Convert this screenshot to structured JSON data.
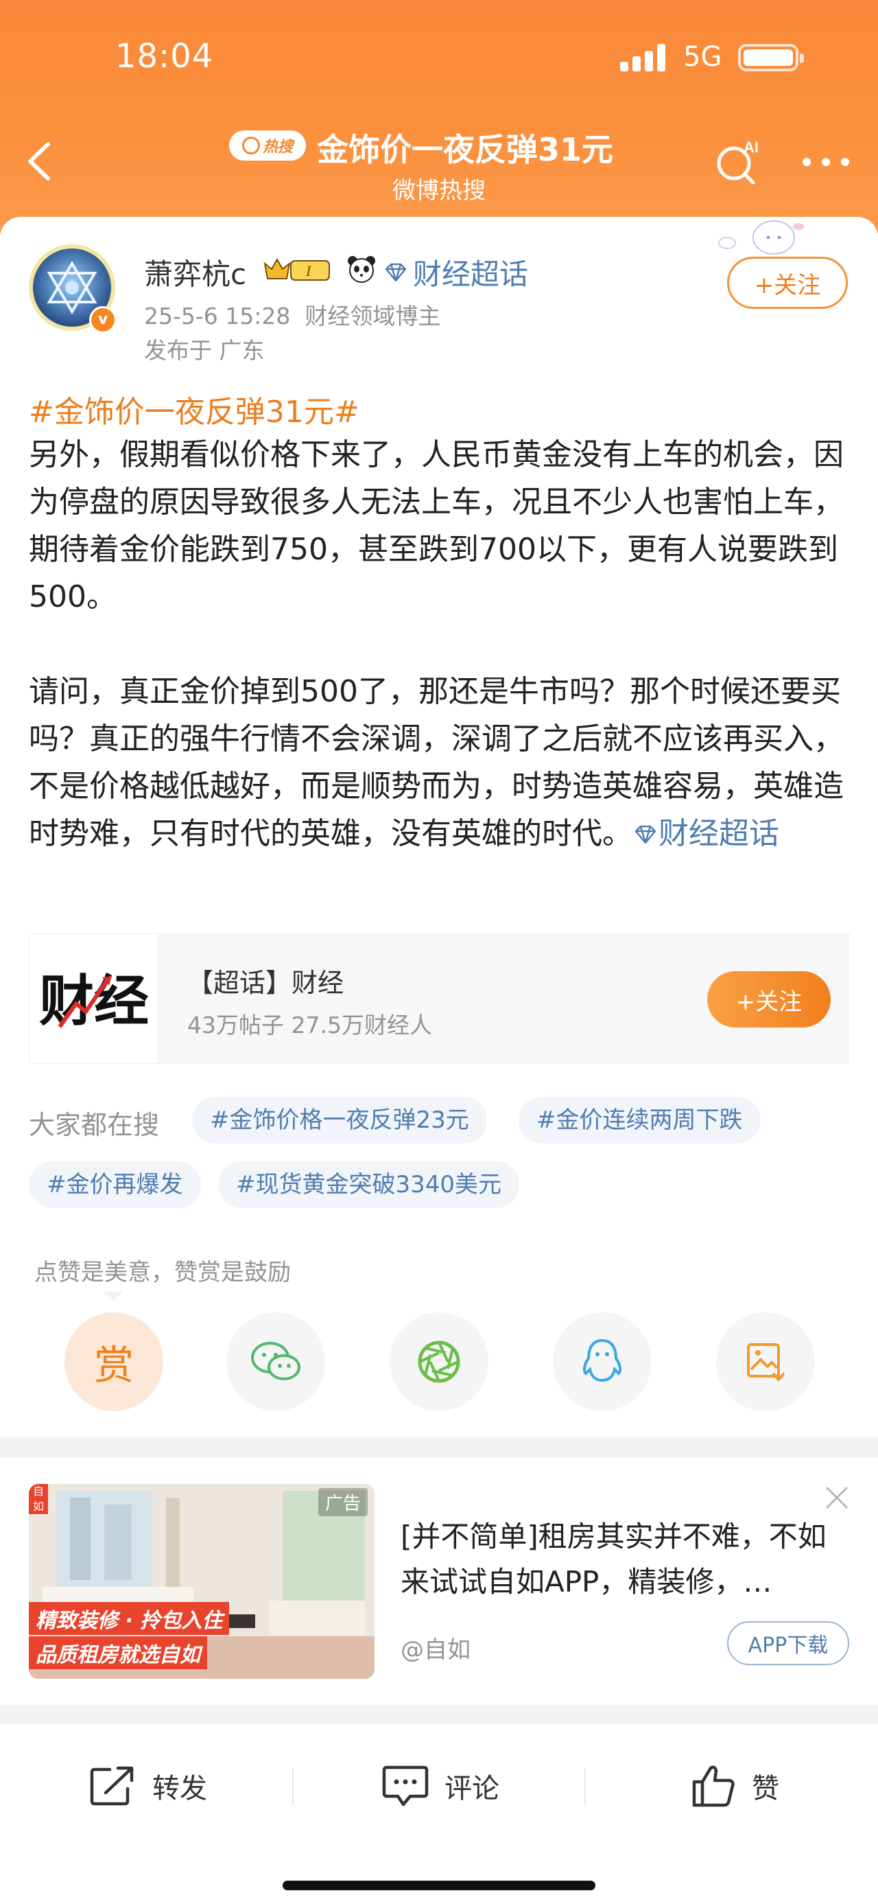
{
  "status_bar": {
    "time": "18:04",
    "network": "5G"
  },
  "header": {
    "hot_badge": "热搜",
    "title": "金饰价一夜反弹31元",
    "subtitle": "微博热搜",
    "ai_label": "AI"
  },
  "post": {
    "username": "萧弈杭c",
    "vip_level": "I",
    "super_topic_link": "财经超话",
    "date": "25-5-6 15:28",
    "identity": "财经领域博主",
    "location": "发布于 广东",
    "follow_label": "+关注",
    "topic": "#金饰价一夜反弹31元#",
    "body_paragraph_1": "另外，假期看似价格下来了，人民币黄金没有上车的机会，因为停盘的原因导致很多人无法上车，况且不少人也害怕上车，期待着金价能跌到750，甚至跌到700以下，更有人说要跌到500。",
    "body_paragraph_2": "请问，真正金价掉到500了，那还是牛市吗？那个时候还要买吗？真正的强牛行情不会深调，深调了之后就不应该再买入，不是价格越低越好，而是顺势而为，时势造英雄容易，英雄造时势难，只有时代的英雄，没有英雄的时代。",
    "inline_link": "财经超话"
  },
  "super_topic_card": {
    "logo_text": "财经",
    "title": "【超话】财经",
    "stats": "43万帖子 27.5万财经人",
    "follow_label": "+关注"
  },
  "search": {
    "label": "大家都在搜",
    "chips": [
      "#金饰价格一夜反弹23元",
      "#金价连续两周下跌",
      "#金价再爆发",
      "#现货黄金突破3340美元"
    ]
  },
  "reward": {
    "hint": "点赞是美意，赞赏是鼓励",
    "reward_label": "赏"
  },
  "ad": {
    "badge": "广告",
    "app_badge": "自如",
    "banner_line_1": "精致装修 · 拎包入住",
    "banner_line_2": "品质租房就选自如",
    "text": "[并不简单]租房其实并不难，不如来试试自如APP，精装修，…",
    "source": "@自如",
    "button": "APP下载"
  },
  "bottom_bar": {
    "repost": "转发",
    "comment": "评论",
    "like": "赞"
  },
  "colors": {
    "header_orange": "#f8893a",
    "link_blue": "#507daf",
    "topic_orange": "#eb7f20"
  }
}
